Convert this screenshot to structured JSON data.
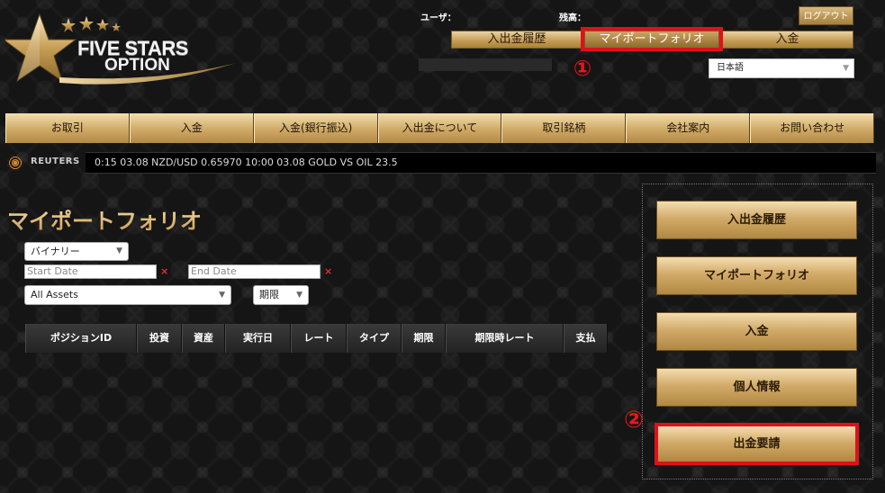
{
  "brand": {
    "name_line1": "FIVE STARS",
    "name_line2": "OPTION",
    "colors": {
      "gold": "#c9a35c",
      "red_highlight": "#e0101a"
    }
  },
  "header": {
    "user_label": "ユーザ：",
    "balance_label": "残高：",
    "logout_label": "ログアウト",
    "tabs": [
      {
        "label": "入出金履歴"
      },
      {
        "label": "マイポートフォリオ"
      },
      {
        "label": "入金"
      }
    ],
    "language": "日本語",
    "markers": {
      "one": "①",
      "two": "②"
    }
  },
  "nav": {
    "items": [
      {
        "label": "お取引"
      },
      {
        "label": "入金"
      },
      {
        "label": "入金(銀行振込)"
      },
      {
        "label": "入出金について"
      },
      {
        "label": "取引銘柄"
      },
      {
        "label": "会社案内"
      },
      {
        "label": "お問い合わせ"
      }
    ]
  },
  "ticker": {
    "source": "REUTERS",
    "text": "0:15 03.08 NZD/USD 0.65970 10:00 03.08 GOLD VS OIL 23.5"
  },
  "main": {
    "title": "マイポートフォリオ",
    "filters": {
      "option_type": "バイナリー",
      "start_date_placeholder": "Start Date",
      "end_date_placeholder": "End Date",
      "clear_symbol": "×",
      "assets": "All Assets",
      "expiry": "期限"
    },
    "table_columns": [
      "ポジションID",
      "投資",
      "資産",
      "実行日",
      "レート",
      "タイプ",
      "期限",
      "期限時レート",
      "支払"
    ]
  },
  "sidebar": {
    "buttons": [
      {
        "label": "入出金履歴"
      },
      {
        "label": "マイポートフォリオ"
      },
      {
        "label": "入金"
      },
      {
        "label": "個人情報"
      },
      {
        "label": "出金要請"
      }
    ]
  }
}
